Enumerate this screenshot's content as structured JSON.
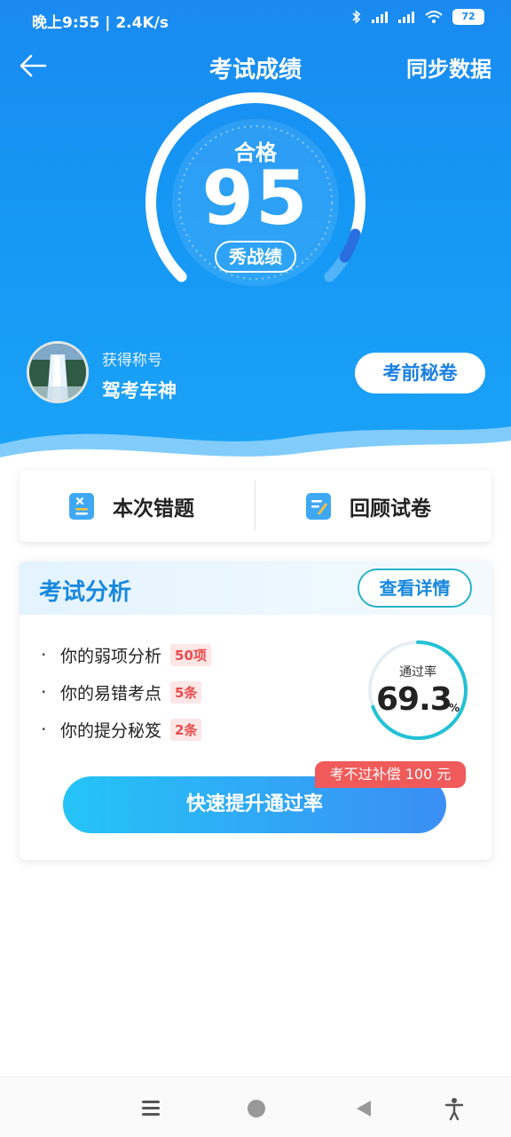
{
  "status_bar": {
    "time_speed": "晚上9:55 | 2.4K/s",
    "battery": "72"
  },
  "header": {
    "title": "考试成绩",
    "sync_label": "同步数据"
  },
  "score": {
    "status": "合格",
    "value": "95",
    "share_label": "秀战绩",
    "gauge_fraction": 0.95
  },
  "profile": {
    "title_label": "获得称号",
    "title_value": "驾考车神",
    "secret_button": "考前秘卷"
  },
  "actions": {
    "wrong_label": "本次错题",
    "review_label": "回顾试卷"
  },
  "analysis": {
    "title": "考试分析",
    "detail_button": "查看详情",
    "items": [
      {
        "label": "你的弱项分析",
        "badge": "50项"
      },
      {
        "label": "你的易错考点",
        "badge": "5条"
      },
      {
        "label": "你的提分秘笈",
        "badge": "2条"
      }
    ],
    "pass_rate_label": "通过率",
    "pass_rate_value": "69.3",
    "pass_rate_unit": "%",
    "pass_rate_fraction": 0.693,
    "cta_button": "快速提升通过率",
    "promo_tag": "考不过补偿 100 元"
  },
  "colors": {
    "hero_blue": "#1a8af0",
    "accent_blue": "#1788de",
    "badge_red": "#ec4b4b",
    "ring_teal": "#22c1d6"
  },
  "icons": {
    "back": "arrow-left-icon",
    "wrong": "wrong-questions-icon",
    "review": "review-paper-icon",
    "menu": "menu-icon",
    "home": "home-icon",
    "back_sys": "triangle-back-icon",
    "accessibility": "accessibility-icon"
  }
}
